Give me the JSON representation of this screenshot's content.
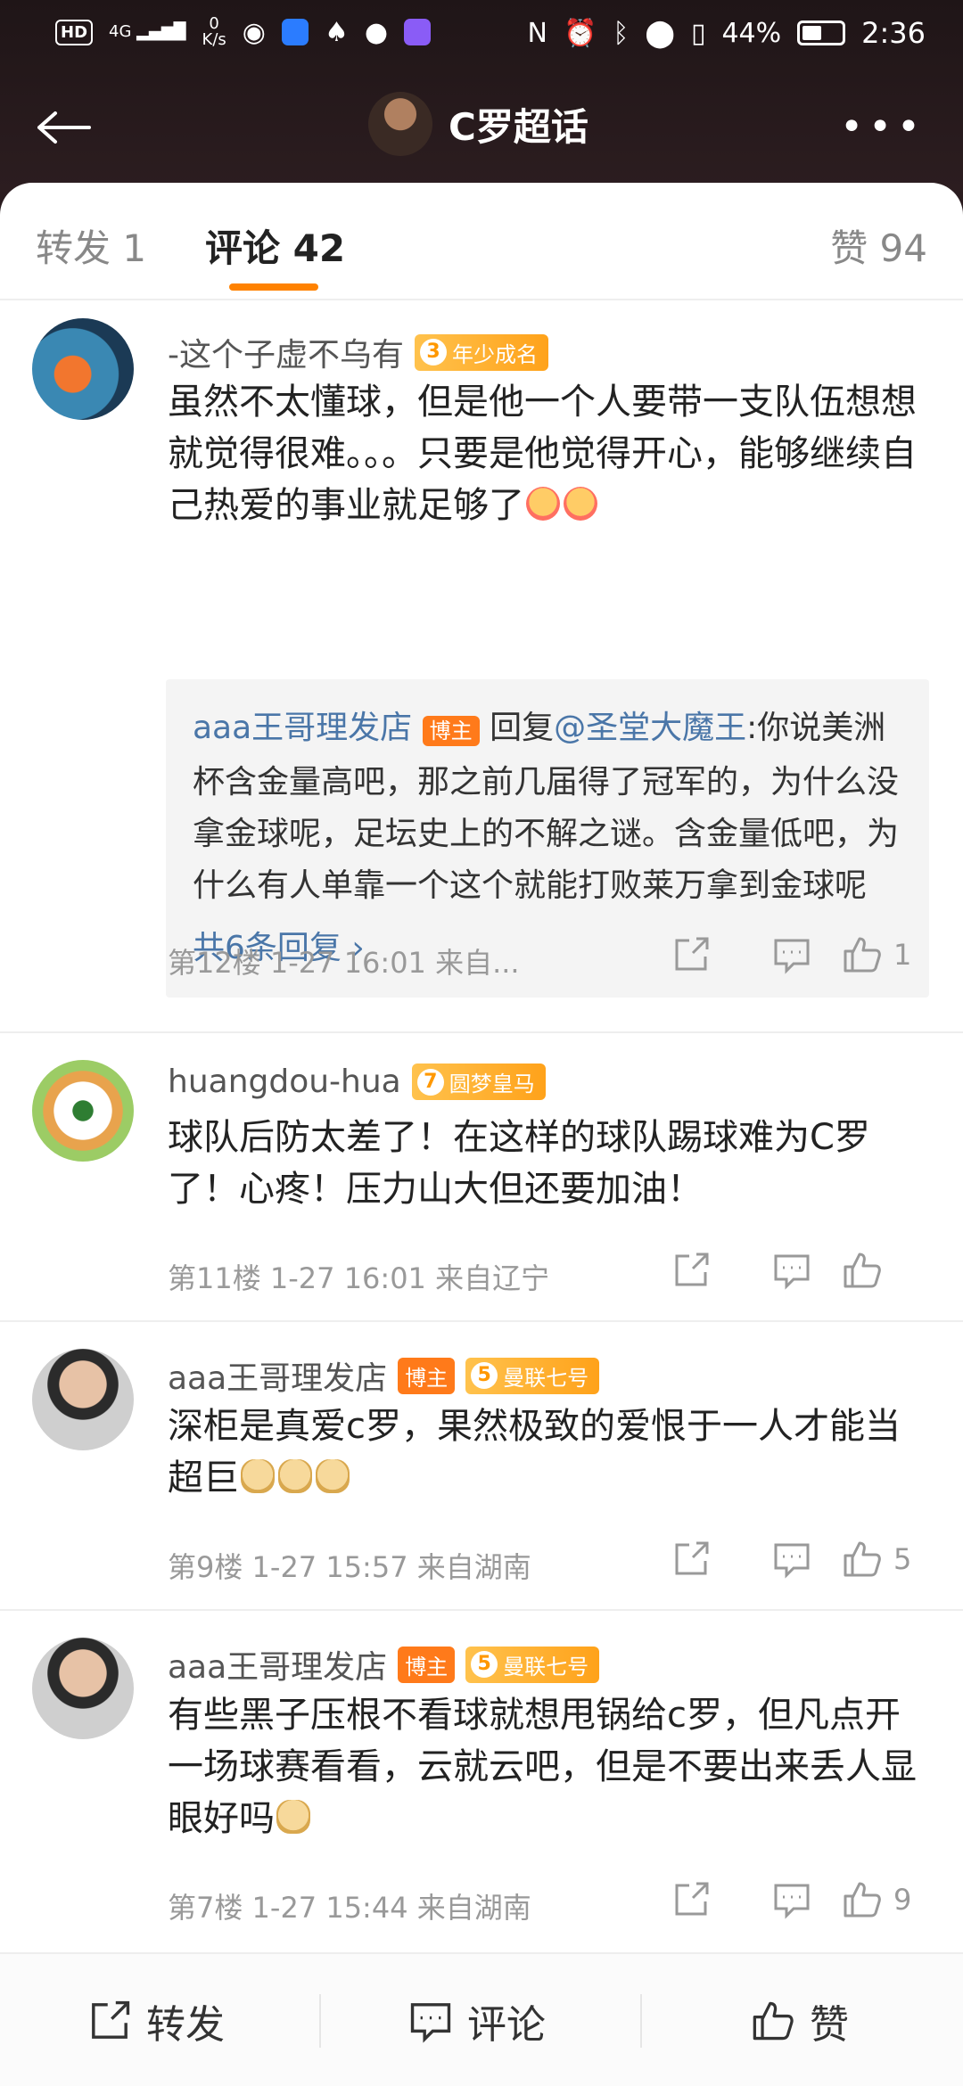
{
  "status_bar": {
    "hd": "HD",
    "net": "4G",
    "speed_top": "0",
    "speed_bottom": "K/s",
    "battery": "44%",
    "time": "2:36"
  },
  "header": {
    "title": "C罗超话"
  },
  "tabs": {
    "repost": "转发 1",
    "comments": "评论 42",
    "likes": "赞 94"
  },
  "comments": [
    {
      "name": "-这个子虚不乌有",
      "level_badge": "3",
      "level_text": "年少成名",
      "text": "虽然不太懂球，但是他一个人要带一支队伍想想就觉得很难。。。只要是他觉得开心，能够继续自己热爱的事业就足够了",
      "reply": {
        "name": "aaa王哥理发店",
        "badge": "博主",
        "prefix": "回复",
        "target": "@圣堂大魔王",
        "text": ":你说美洲杯含金量高吧，那之前几届得了冠军的，为什么没拿金球呢，足坛史上的不解之谜。含金量低吧，为什么有人单靠一个这个就能打败莱万拿到金球呢",
        "more": "共6条回复 ›"
      },
      "meta": "第12楼  1-27 16:01  来自...",
      "likes": "1"
    },
    {
      "name": "huangdou-hua",
      "level_badge": "7",
      "level_text": "圆梦皇马",
      "text": "球队后防太差了！在这样的球队踢球难为C罗了！心疼！压力山大但还要加油！",
      "meta": "第11楼  1-27 16:01  来自辽宁",
      "likes": ""
    },
    {
      "name": "aaa王哥理发店",
      "badge": "博主",
      "level_badge": "5",
      "level_text": "曼联七号",
      "text": "深柜是真爱c罗，果然极致的爱恨于一人才能当超巨",
      "meta": "第9楼  1-27 15:57  来自湖南",
      "likes": "5"
    },
    {
      "name": "aaa王哥理发店",
      "badge": "博主",
      "level_badge": "5",
      "level_text": "曼联七号",
      "text": "有些黑子压根不看球就想甩锅给c罗，但凡点开一场球赛看看，云就云吧，但是不要出来丢人显眼好吗",
      "meta": "第7楼  1-27 15:44  来自湖南",
      "likes": "9"
    }
  ],
  "bottom_bar": {
    "repost": "转发",
    "comment": "评论",
    "like": "赞"
  },
  "colors": {
    "accent": "#ff8200",
    "link": "#4a76a8",
    "header_bg": "#2a1c1f"
  }
}
